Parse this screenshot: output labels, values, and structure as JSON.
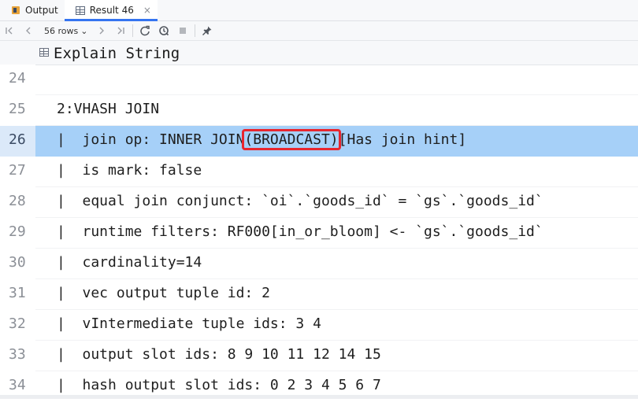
{
  "tabs": [
    {
      "label": "Output",
      "icon": "output-icon",
      "active": false
    },
    {
      "label": "Result 46",
      "icon": "grid-icon",
      "active": true,
      "close": "×"
    }
  ],
  "toolbar": {
    "rows_label": "56 rows",
    "rows_chevron": "⌄"
  },
  "column": {
    "header": "Explain String"
  },
  "rows": [
    {
      "num": "24",
      "text": ""
    },
    {
      "num": "25",
      "text": "2:VHASH JOIN"
    },
    {
      "num": "26",
      "text_before": "|  join op: INNER JOIN",
      "text_highlight": "(BROADCAST)",
      "text_after": "[Has join hint]"
    },
    {
      "num": "27",
      "text": "|  is mark: false"
    },
    {
      "num": "28",
      "text": "|  equal join conjunct: `oi`.`goods_id` = `gs`.`goods_id`"
    },
    {
      "num": "29",
      "text": "|  runtime filters: RF000[in_or_bloom] <- `gs`.`goods_id`"
    },
    {
      "num": "30",
      "text": "|  cardinality=14"
    },
    {
      "num": "31",
      "text": "|  vec output tuple id: 2"
    },
    {
      "num": "32",
      "text": "|  vIntermediate tuple ids: 3 4"
    },
    {
      "num": "33",
      "text": "|  output slot ids: 8 9 10 11 12 14 15"
    },
    {
      "num": "34",
      "text": "|  hash output slot ids: 0 2 3 4 5 6 7"
    }
  ],
  "colors": {
    "selection": "#a6d0f8",
    "highlight_border": "#e8262f",
    "tab_accent": "#3574f0"
  }
}
